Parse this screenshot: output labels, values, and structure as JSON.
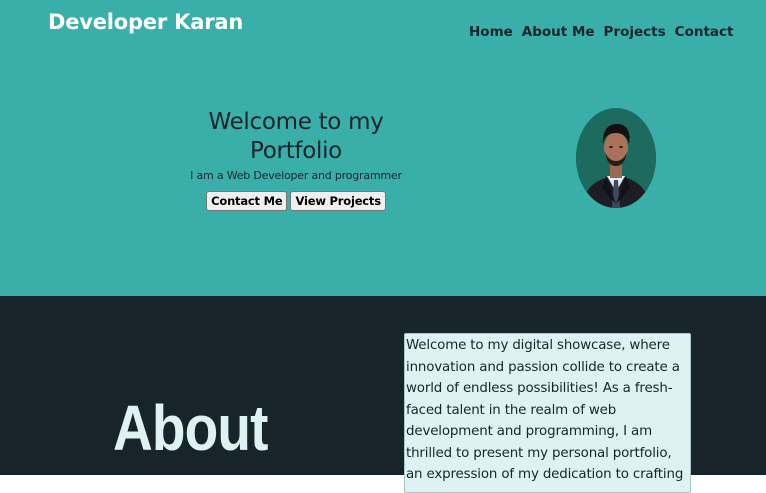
{
  "header": {
    "brand": "Developer Karan",
    "nav": [
      "Home",
      "About Me",
      "Projects",
      "Contact"
    ]
  },
  "hero": {
    "heading": "Welcome to my Portfolio",
    "subtitle": "I am a Web Developer and programmer",
    "buttons": [
      "Contact Me",
      "View Projects"
    ]
  },
  "about": {
    "title": "About",
    "text": "Welcome to my digital showcase, where innovation and passion collide to create a world of endless possibilities! As a fresh-faced talent in the realm of web development and programming, I am thrilled to present my personal portfolio, an expression of my dedication to crafting"
  },
  "colors": {
    "hero_bg": "#3aafa9",
    "about_bg": "#17252a",
    "text_box_bg": "#def2f1"
  }
}
